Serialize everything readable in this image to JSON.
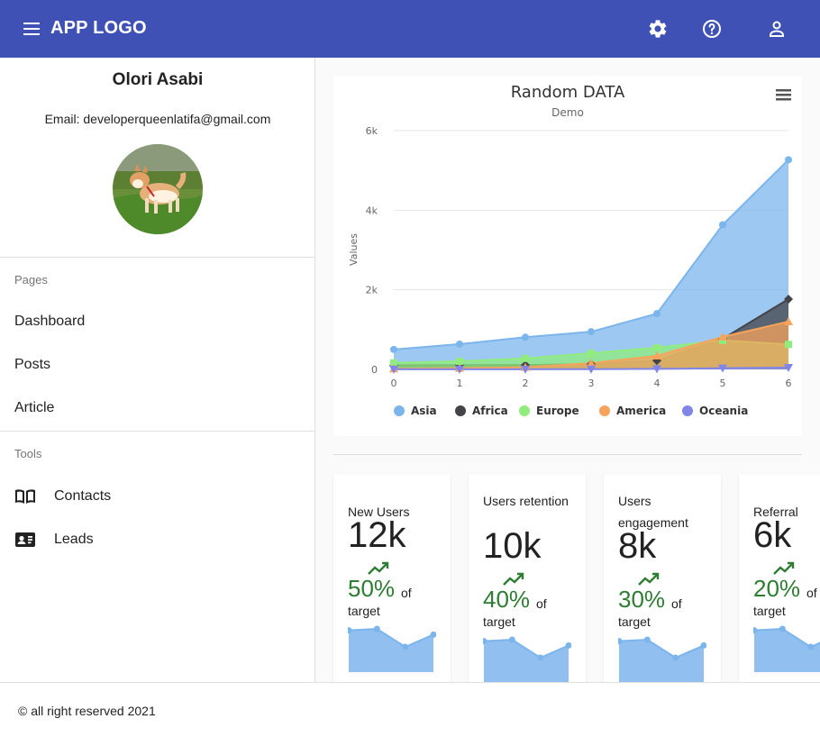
{
  "header": {
    "logo": "APP LOGO",
    "icons": [
      "menu-icon",
      "gear-icon",
      "help-icon",
      "account-icon"
    ],
    "color": "#3f51b5"
  },
  "profile": {
    "name": "Olori Asabi",
    "email": "Email: developerqueenlatifa@gmail.com"
  },
  "sidebar": {
    "pages_title": "Pages",
    "pages": [
      "Dashboard",
      "Posts",
      "Article"
    ],
    "tools_title": "Tools",
    "tools": [
      {
        "label": "Contacts",
        "icon": "book-icon"
      },
      {
        "label": "Leads",
        "icon": "contact-card-icon"
      }
    ]
  },
  "chart_data": {
    "type": "area",
    "title": "Random DATA",
    "subtitle": "Demo",
    "xlabel": "",
    "ylabel": "Values",
    "x": [
      0,
      1,
      2,
      3,
      4,
      5,
      6
    ],
    "ylim": [
      0,
      6000
    ],
    "yticks": [
      "0",
      "2k",
      "4k",
      "6k"
    ],
    "grid": true,
    "legend_position": "bottom",
    "series": [
      {
        "name": "Asia",
        "color": "#7cb5ec",
        "marker": "circle",
        "values": [
          502,
          635,
          809,
          947,
          1402,
          3634,
          5268
        ]
      },
      {
        "name": "Africa",
        "color": "#434348",
        "marker": "diamond",
        "values": [
          106,
          107,
          111,
          133,
          221,
          767,
          1766
        ]
      },
      {
        "name": "Europe",
        "color": "#90ed7d",
        "marker": "square",
        "values": [
          163,
          203,
          276,
          408,
          547,
          729,
          628
        ]
      },
      {
        "name": "America",
        "color": "#f7a35c",
        "marker": "triangle",
        "values": [
          18,
          31,
          54,
          156,
          339,
          818,
          1201
        ]
      },
      {
        "name": "Oceania",
        "color": "#8085e9",
        "marker": "triangle-down",
        "values": [
          2,
          2,
          2,
          6,
          13,
          30,
          46
        ]
      }
    ]
  },
  "stats": [
    {
      "title": "New Users",
      "value": "12k",
      "percent": "50%",
      "of": "of",
      "target": "target",
      "spark": [
        58,
        60,
        35,
        52
      ]
    },
    {
      "title": "Users retention",
      "value": "10k",
      "percent": "40%",
      "of": "of",
      "target": "target",
      "spark": [
        58,
        60,
        35,
        52
      ]
    },
    {
      "title": "Users engagement",
      "value": "8k",
      "percent": "30%",
      "of": "of",
      "target": "target",
      "spark": [
        58,
        60,
        35,
        52
      ]
    },
    {
      "title": "Referral",
      "value": "6k",
      "percent": "20%",
      "of": "of",
      "target": "target",
      "spark": [
        58,
        60,
        35,
        52
      ]
    }
  ],
  "footer": {
    "text": "© all right reserved 2021"
  }
}
